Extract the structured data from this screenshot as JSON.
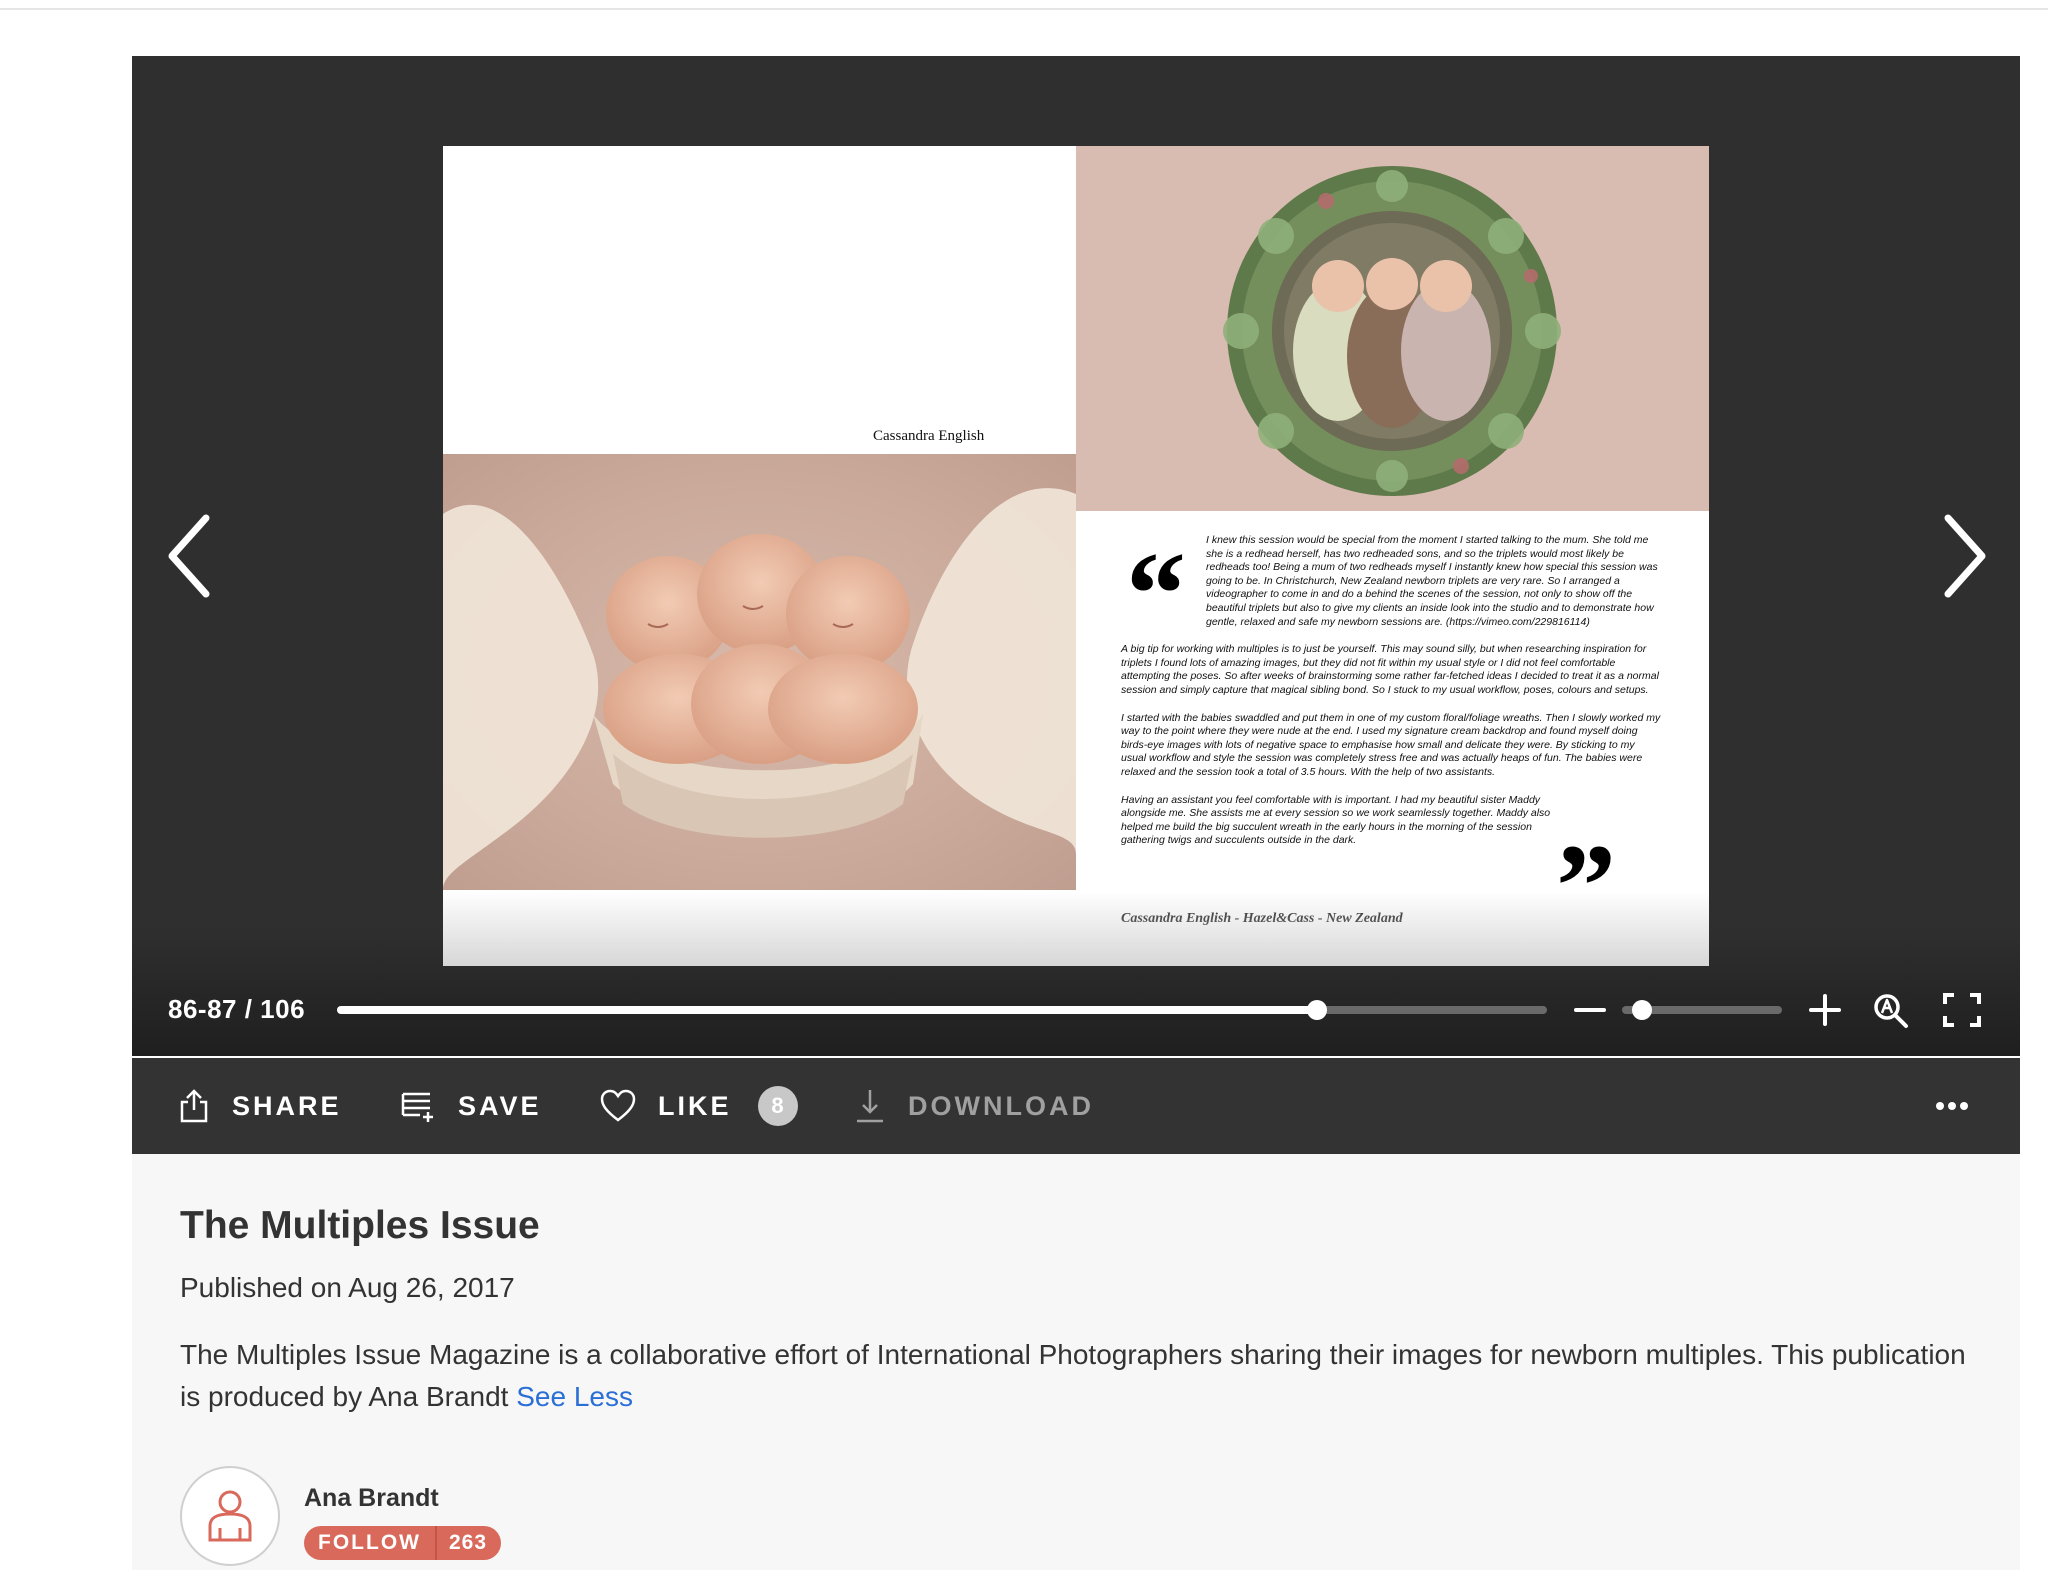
{
  "viewer": {
    "page_indicator": "86-87 / 106",
    "progress_fraction": 0.81,
    "zoom_fraction": 0.06,
    "spread": {
      "left_page_credit": "Cassandra English",
      "paragraphs": [
        "I knew this session would be special from the moment I started talking to the mum. She told me she is a redhead herself, has two redheaded sons, and so the triplets would most likely be redheads too! Being a mum of two redheads myself I instantly knew how special this session was going to be. In Christchurch, New Zealand newborn triplets are very rare. So I arranged a videographer to come in and do a behind the scenes of the session, not only to show off the beautiful triplets but also to give my clients an inside look into the studio and to demonstrate how gentle, relaxed and safe my newborn sessions are. (https://vimeo.com/229816114)",
        "A big tip for working with multiples is to just be yourself. This may sound silly, but when researching inspiration for triplets I found lots of amazing images, but they did not fit within my usual style or I did not feel comfortable attempting the poses. So after weeks of brainstorming some rather far-fetched ideas I decided to treat it as a normal session and simply capture that magical sibling bond. So I stuck to my usual workflow, poses, colours and setups.",
        "I started with the babies swaddled and put them in one of my custom floral/foliage wreaths. Then I slowly worked my way to the point where they were nude at the end. I used my signature cream backdrop and found myself doing birds-eye images with lots of negative space to emphasise how small and delicate they were. By sticking to my usual workflow and style the session was completely stress free and was actually heaps of fun. The babies were relaxed and the session took a total of 3.5 hours. With the help of two assistants.",
        "Having an assistant you feel comfortable with is important. I had my beautiful sister Maddy alongside me. She assists me at every session so we work seamlessly together. Maddy also helped me build the big succulent wreath in the early hours in the morning of the session gathering twigs and succulents outside in the dark."
      ],
      "quote_open": "“",
      "quote_close": "”",
      "signature": "Cassandra English - Hazel&Cass - New Zealand"
    }
  },
  "actions": {
    "share": "SHARE",
    "save": "SAVE",
    "like": "LIKE",
    "like_count": "8",
    "download": "DOWNLOAD"
  },
  "publication": {
    "title": "The Multiples Issue",
    "published": "Published on Aug 26, 2017",
    "description": "The Multiples Issue Magazine is a collaborative effort of International Photographers sharing their images for newborn multiples. This publication is produced by Ana Brandt",
    "see_less": "See Less"
  },
  "author": {
    "name": "Ana Brandt",
    "follow_label": "FOLLOW",
    "follower_count": "263"
  },
  "colors": {
    "viewer_bg": "#2f2f2f",
    "actionbar_bg": "#333333",
    "follow_bg": "#d8695b",
    "link": "#2a6fd6"
  }
}
